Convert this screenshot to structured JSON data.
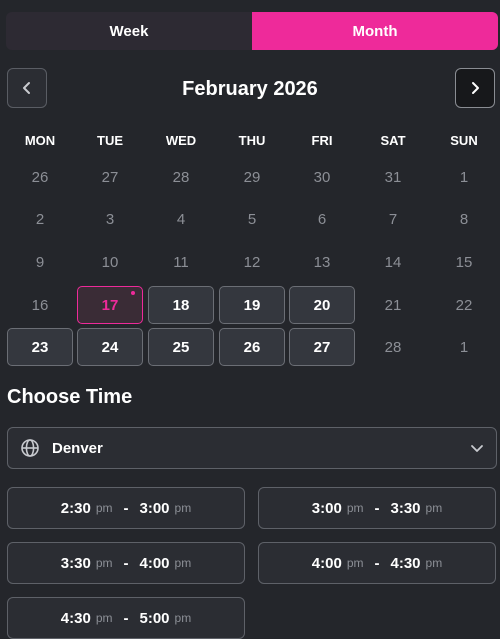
{
  "toggle": {
    "week_label": "Week",
    "month_label": "Month",
    "selected": "Month"
  },
  "calendar": {
    "title": "February 2026",
    "weekdays": [
      "MON",
      "TUE",
      "WED",
      "THU",
      "FRI",
      "SAT",
      "SUN"
    ],
    "weeks": [
      [
        "26",
        "27",
        "28",
        "29",
        "30",
        "31",
        "1"
      ],
      [
        "2",
        "3",
        "4",
        "5",
        "6",
        "7",
        "8"
      ],
      [
        "9",
        "10",
        "11",
        "12",
        "13",
        "14",
        "15"
      ],
      [
        "16",
        "17",
        "18",
        "19",
        "20",
        "21",
        "22"
      ],
      [
        "23",
        "24",
        "25",
        "26",
        "27",
        "28",
        "1"
      ]
    ],
    "today": "17",
    "available_days": [
      "17",
      "18",
      "19",
      "20",
      "23",
      "24",
      "25",
      "26",
      "27"
    ]
  },
  "time_section": {
    "title": "Choose Time",
    "timezone": {
      "value": "Denver",
      "icon": "globe-icon"
    },
    "slots": [
      {
        "start": "2:30",
        "start_ap": "pm",
        "end": "3:00",
        "end_ap": "pm"
      },
      {
        "start": "3:00",
        "start_ap": "pm",
        "end": "3:30",
        "end_ap": "pm"
      },
      {
        "start": "3:30",
        "start_ap": "pm",
        "end": "4:00",
        "end_ap": "pm"
      },
      {
        "start": "4:00",
        "start_ap": "pm",
        "end": "4:30",
        "end_ap": "pm"
      },
      {
        "start": "4:30",
        "start_ap": "pm",
        "end": "5:00",
        "end_ap": "pm"
      }
    ]
  },
  "colors": {
    "accent": "#ee2a9a",
    "background": "#24262b",
    "muted_text": "#8c8f96"
  }
}
